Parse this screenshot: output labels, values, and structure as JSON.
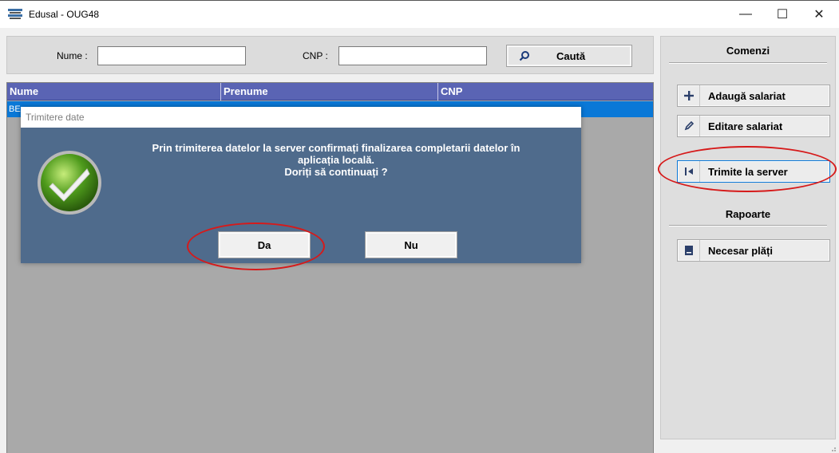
{
  "window": {
    "title": "Edusal - OUG48",
    "controls": {
      "minimize": "—",
      "maximize": "☐",
      "close": "✕"
    }
  },
  "search": {
    "name_label": "Nume :",
    "name_value": "",
    "cnp_label": "CNP :",
    "cnp_value": "",
    "button_label": "Caută"
  },
  "grid": {
    "columns": [
      "Nume",
      "Prenume",
      "CNP"
    ],
    "rows": [
      {
        "nume": "BE",
        "prenume": "",
        "cnp": ""
      }
    ]
  },
  "commands": {
    "title": "Comenzi",
    "add_label": "Adaugă salariat",
    "edit_label": "Editare salariat",
    "send_label": "Trimite la server"
  },
  "reports": {
    "title": "Rapoarte",
    "payments_label": "Necesar plăți"
  },
  "dialog": {
    "title": "Trimitere date",
    "message_line1": "Prin trimiterea datelor la server confirmați finalizarea completarii datelor în",
    "message_line2": "aplicația locală.",
    "message_line3": "Doriți să continuați ?",
    "yes_label": "Da",
    "no_label": "Nu"
  },
  "colors": {
    "grid_header": "#5a64b4",
    "selected_row": "#0a78d7",
    "dialog_bg": "#4f6b8c",
    "annotation": "#d61a1a"
  }
}
